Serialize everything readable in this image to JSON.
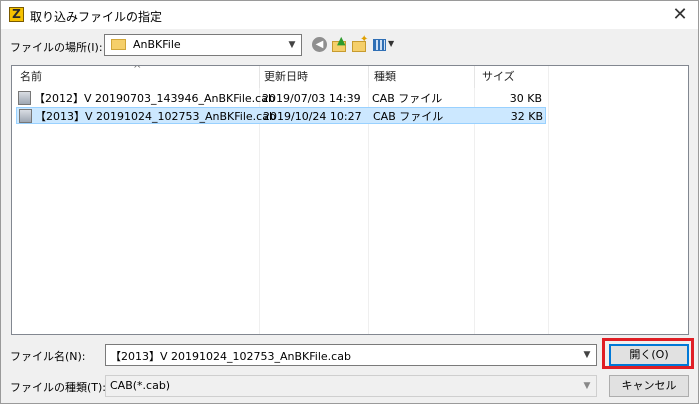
{
  "window": {
    "title": "取り込みファイルの指定",
    "app_icon_glyph": "Z"
  },
  "lookin": {
    "label": "ファイルの場所(I):",
    "value": "AnBKFile"
  },
  "list": {
    "headers": {
      "name": "名前",
      "date": "更新日時",
      "type": "種類",
      "size": "サイズ"
    },
    "rows": [
      {
        "name": "【2012】V 20190703_143946_AnBKFile.cab",
        "date": "2019/07/03 14:39",
        "type": "CAB ファイル",
        "size": "30 KB",
        "selected": false
      },
      {
        "name": "【2013】V 20191024_102753_AnBKFile.cab",
        "date": "2019/10/24 10:27",
        "type": "CAB ファイル",
        "size": "32 KB",
        "selected": true
      }
    ]
  },
  "filename": {
    "label": "ファイル名(N):",
    "value": "【2013】V 20191024_102753_AnBKFile.cab"
  },
  "filetype": {
    "label": "ファイルの種類(T):",
    "value": "CAB(*.cab)"
  },
  "buttons": {
    "open": "開く(O)",
    "cancel": "キャンセル",
    "close": "✕"
  },
  "colors": {
    "selection": "#cce8ff",
    "highlight": "#e01e25",
    "default_button_border": "#0078d7"
  }
}
